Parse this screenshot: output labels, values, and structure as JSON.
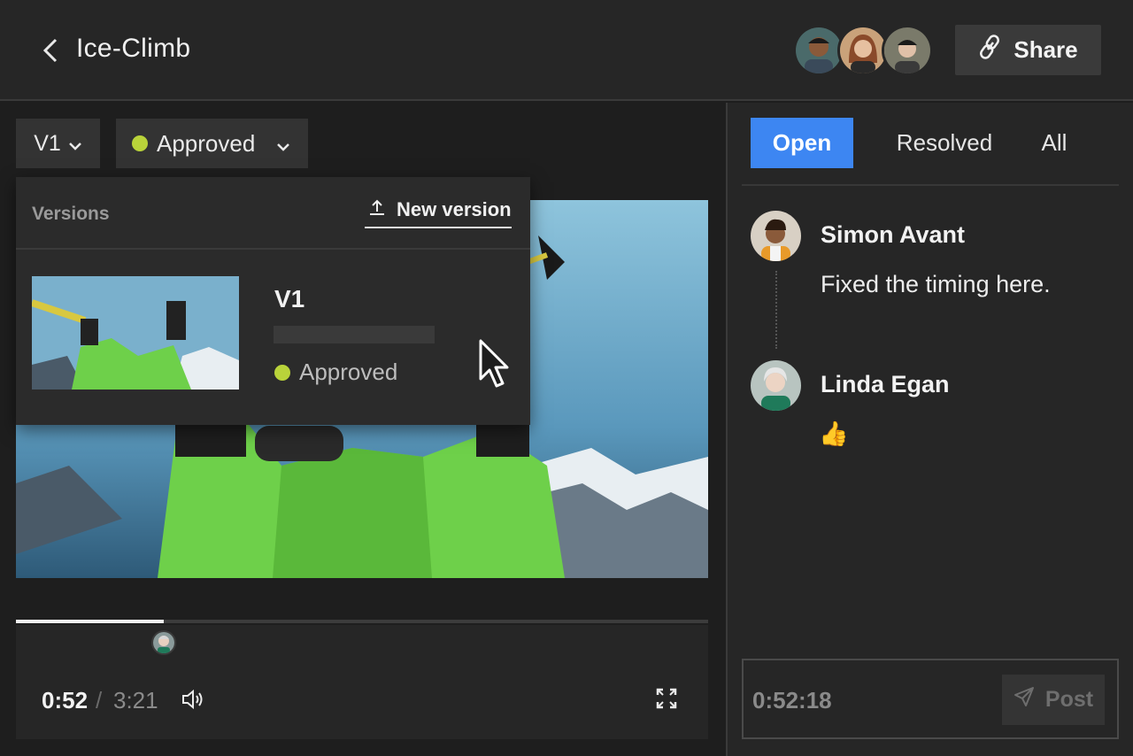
{
  "header": {
    "title": "Ice-Climb",
    "share_label": "Share",
    "collaborators": [
      "collaborator-avatar-1",
      "collaborator-avatar-2",
      "collaborator-avatar-3"
    ]
  },
  "toolbar": {
    "version_label": "V1",
    "status_label": "Approved",
    "status_color": "#b9d33a"
  },
  "versions_popup": {
    "heading": "Versions",
    "new_version_label": "New version",
    "items": [
      {
        "label": "V1",
        "status": "Approved"
      }
    ]
  },
  "player": {
    "current_time": "0:52",
    "separator": "/",
    "total_time": "3:21",
    "progress": 0.213
  },
  "comments_panel": {
    "tabs": [
      {
        "label": "Open",
        "active": true
      },
      {
        "label": "Resolved",
        "active": false
      },
      {
        "label": "All",
        "active": false
      }
    ],
    "comments": [
      {
        "author": "Simon Avant",
        "text": "Fixed the timing here."
      },
      {
        "author": "Linda Egan",
        "text": "👍"
      }
    ],
    "input_timestamp": "0:52:18",
    "post_label": "Post"
  },
  "colors": {
    "accent": "#3d86f2",
    "approved": "#b9d33a",
    "background": "#1e1e1e",
    "panel": "#262626"
  }
}
